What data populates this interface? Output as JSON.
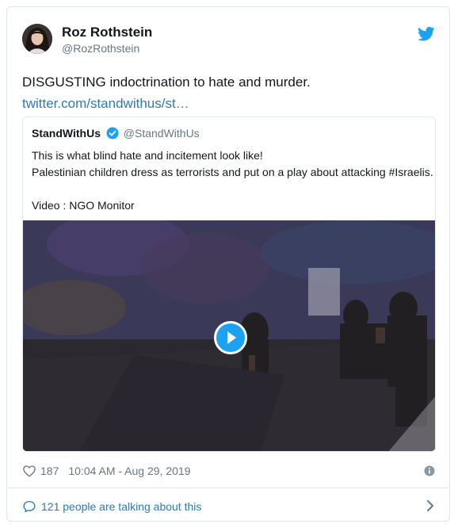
{
  "tweet": {
    "author_name": "Roz Rothstein",
    "author_handle": "@RozRothstein",
    "text": "DISGUSTING indoctrination to hate and murder.",
    "link_text": "twitter.com/standwithus/st…",
    "like_count": "187",
    "timestamp": "10:04 AM - Aug 29, 2019",
    "talking_text": "121 people are talking about this"
  },
  "quoted": {
    "author_name": "StandWithUs",
    "author_handle": "@StandWithUs",
    "line1": "This is what blind hate and incitement look like!",
    "line2": "Palestinian children dress as terrorists and put on a play about attacking #Israelis.",
    "line3": "Video : NGO Monitor"
  },
  "colors": {
    "brand_blue": "#1da1f2",
    "link_blue": "#2b7bb9",
    "muted": "#657786",
    "border": "#e1e8ed"
  },
  "icons": [
    "twitter-bird-icon",
    "verified-badge-icon",
    "play-icon",
    "heart-icon",
    "info-icon",
    "comment-bubble-icon",
    "chevron-right-icon"
  ]
}
